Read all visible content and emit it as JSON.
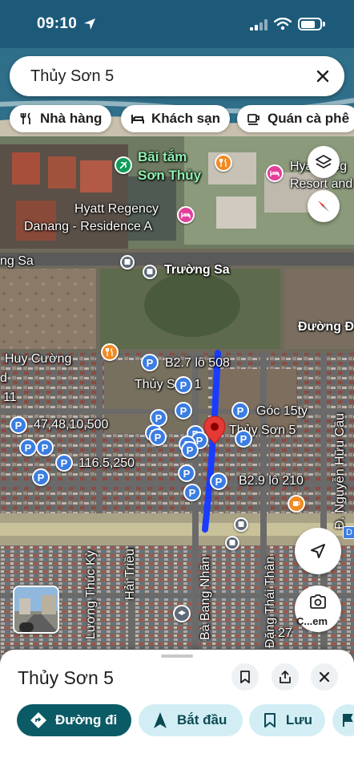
{
  "status_bar": {
    "time": "09:10"
  },
  "search": {
    "query": "Thủy Sơn 5"
  },
  "chips": [
    {
      "label": "Nhà hàng",
      "icon": "fork-knife-icon"
    },
    {
      "label": "Khách sạn",
      "icon": "bed-icon"
    },
    {
      "label": "Quán cà phê",
      "icon": "coffee-icon"
    }
  ],
  "map": {
    "labels": {
      "beach": [
        "Bãi tắm",
        "Sơn Thủy"
      ],
      "hyatt_resort": [
        "Hyatt Reg",
        "Resort and"
      ],
      "hyatt_residence": [
        "Hyatt Regency",
        "Danang - Residence A"
      ],
      "truong_sa_left": "ng Sa",
      "truong_sa": "Trường Sa",
      "duong_d": "Đường Đ",
      "huy_cuong": "Huy Cường",
      "d_left": "d",
      "eleven": "11",
      "b27": "B2.7 lô 508",
      "thuy_son_1": "Thủy Sơn 1",
      "goc": "Góc 15ty",
      "thuy_son_5": "Thủy Sơn 5",
      "p4748": "47,48,10,500",
      "p1165": "116.5,250",
      "b29": "B2.9 lô 210",
      "nguyen_huu_cau": "Đ. Nguyễn Hữu Cầu",
      "luong_thuc_ky": "Lương Thúc Kỳ",
      "hai_trieu": "Hải Triều",
      "ba_bang_nhan": "Bà Bang Nhãn",
      "dang_thai_than": "Đặng Thái Thân",
      "num27": "27",
      "d_badge": "D"
    },
    "pin_glyph": "P",
    "route_color": "#1a3cff",
    "marker_color": "#e53935"
  },
  "map_buttons": {
    "layers": "layers-icon",
    "compass": "compass-icon",
    "locate": "navigation-arrow-icon",
    "lens_label": "C...em"
  },
  "sheet": {
    "title": "Thủy Sơn 5",
    "actions": [
      {
        "label": "Đường đi",
        "icon": "directions-icon"
      },
      {
        "label": "Bắt đầu",
        "icon": "navigation-arrow-icon"
      },
      {
        "label": "Lưu",
        "icon": "bookmark-icon"
      }
    ]
  },
  "colors": {
    "primary": "#0b5b66",
    "secondary": "#d2eef4",
    "pin": "#3b7de2"
  }
}
